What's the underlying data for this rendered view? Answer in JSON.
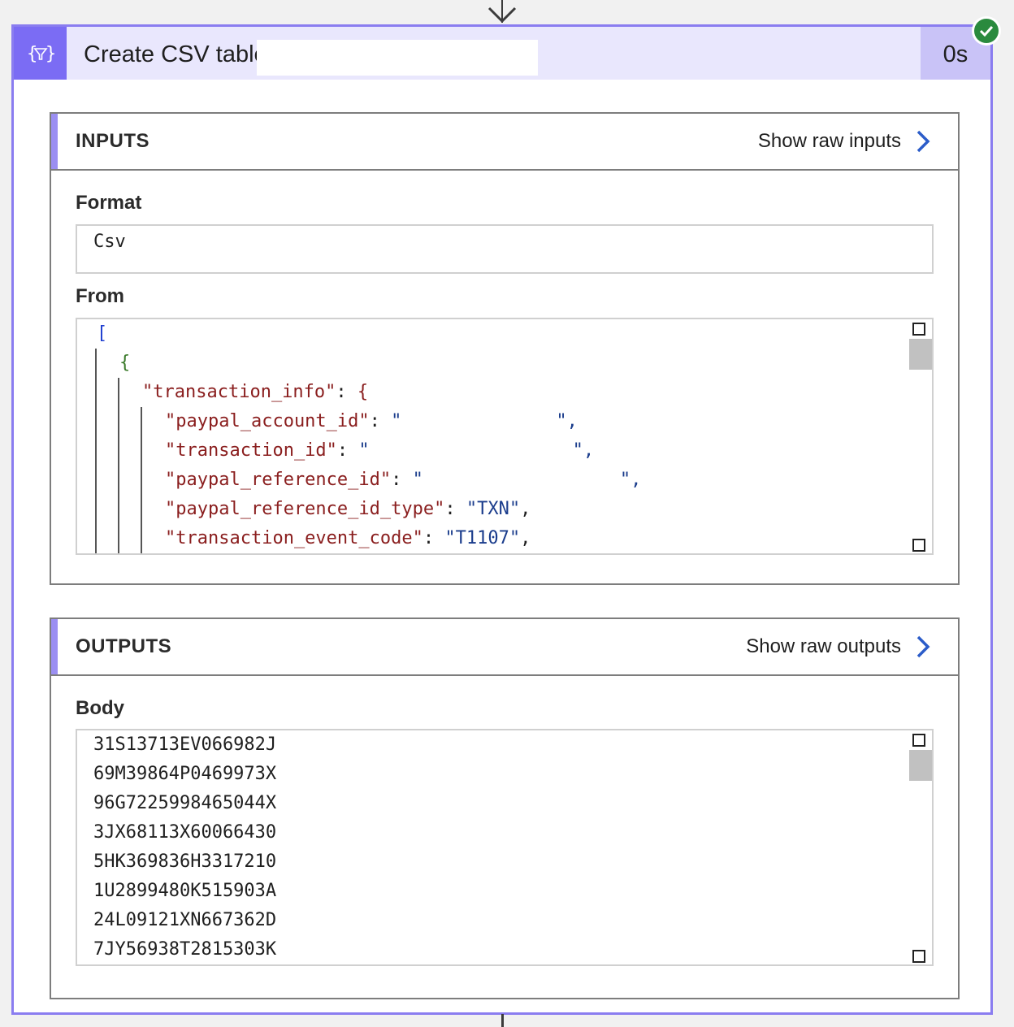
{
  "action": {
    "title": "Create CSV table",
    "duration": "0s",
    "status": "succeeded",
    "icon": "data-operation-icon"
  },
  "inputs": {
    "heading": "INPUTS",
    "raw_link": "Show raw inputs",
    "format_label": "Format",
    "format_value": "Csv",
    "from_label": "From",
    "from_lines": [
      {
        "indent": 0,
        "open": "["
      },
      {
        "indent": 1,
        "open": "{"
      },
      {
        "indent": 2,
        "key": "\"transaction_info\"",
        "sep": ": ",
        "brace": "{"
      },
      {
        "indent": 3,
        "key": "\"paypal_account_id\"",
        "sep": ": ",
        "val": "\"",
        "tail": "\","
      },
      {
        "indent": 3,
        "key": "\"transaction_id\"",
        "sep": ": ",
        "val": "\"",
        "tail": "\","
      },
      {
        "indent": 3,
        "key": "\"paypal_reference_id\"",
        "sep": ": ",
        "val": "\"",
        "tail": "\","
      },
      {
        "indent": 3,
        "key": "\"paypal_reference_id_type\"",
        "sep": ": ",
        "val": "\"TXN\"",
        "tail": ","
      },
      {
        "indent": 3,
        "key": "\"transaction_event_code\"",
        "sep": ": ",
        "val": "\"T1107\"",
        "tail": ","
      }
    ]
  },
  "outputs": {
    "heading": "OUTPUTS",
    "raw_link": "Show raw outputs",
    "body_label": "Body",
    "body_lines": [
      "31S13713EV066982J",
      "69M39864P0469973X",
      "96G7225998465044X",
      "3JX68113X60066430",
      "5HK369836H3317210",
      "1U2899480K515903A",
      "24L09121XN667362D",
      "7JY56938T2815303K"
    ]
  },
  "colors": {
    "accent": "#7b6cf4",
    "header_bg": "#e9e7fd",
    "success": "#2a8a3e",
    "link_chevron": "#2b5cc9"
  }
}
